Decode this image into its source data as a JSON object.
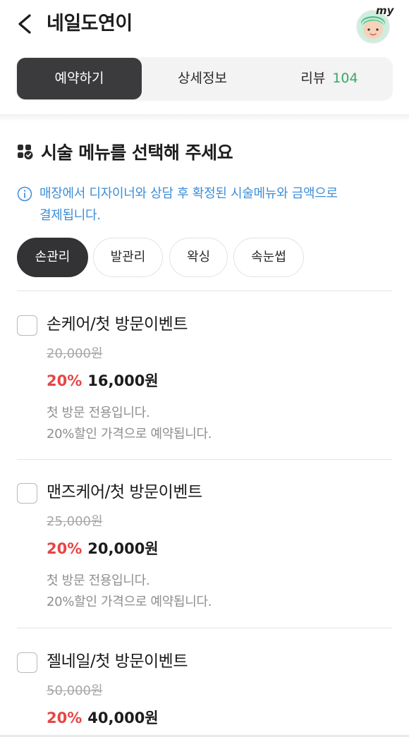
{
  "header": {
    "title": "네일도연이",
    "back_icon": "chevron-left-icon",
    "my_icon": "my-avatar-icon",
    "my_label": "my"
  },
  "tabs": [
    {
      "label": "예약하기",
      "active": true
    },
    {
      "label": "상세정보",
      "active": false
    },
    {
      "label": "리뷰",
      "count": "104",
      "active": false
    }
  ],
  "section": {
    "title": "시술 메뉴를 선택해 주세요",
    "icon": "menu-check-icon"
  },
  "notice": {
    "icon": "info-icon",
    "text_line1": "매장에서 디자이너와 상담 후 확정된 시술메뉴와 금액으로",
    "text_line2": "결제됩니다."
  },
  "categories": [
    {
      "label": "손관리",
      "active": true
    },
    {
      "label": "발관리",
      "active": false
    },
    {
      "label": "왁싱",
      "active": false
    },
    {
      "label": "속눈썹",
      "active": false
    }
  ],
  "items": [
    {
      "name": "손케어/첫 방문이벤트",
      "original_price": "20,000원",
      "discount": "20%",
      "price": "16,000원",
      "desc_line1": "첫 방문 전용입니다.",
      "desc_line2": "20%할인 가격으로 예약됩니다.",
      "checked": false
    },
    {
      "name": "맨즈케어/첫 방문이벤트",
      "original_price": "25,000원",
      "discount": "20%",
      "price": "20,000원",
      "desc_line1": "첫 방문 전용입니다.",
      "desc_line2": "20%할인 가격으로 예약됩니다.",
      "checked": false
    },
    {
      "name": "젤네일/첫 방문이벤트",
      "original_price": "50,000원",
      "discount": "20%",
      "price": "40,000원",
      "checked": false
    }
  ],
  "colors": {
    "accent_dark": "#3b3b3d",
    "review_count": "#3aa66a",
    "notice_blue": "#3c8ed8",
    "discount_red": "#e64545"
  }
}
